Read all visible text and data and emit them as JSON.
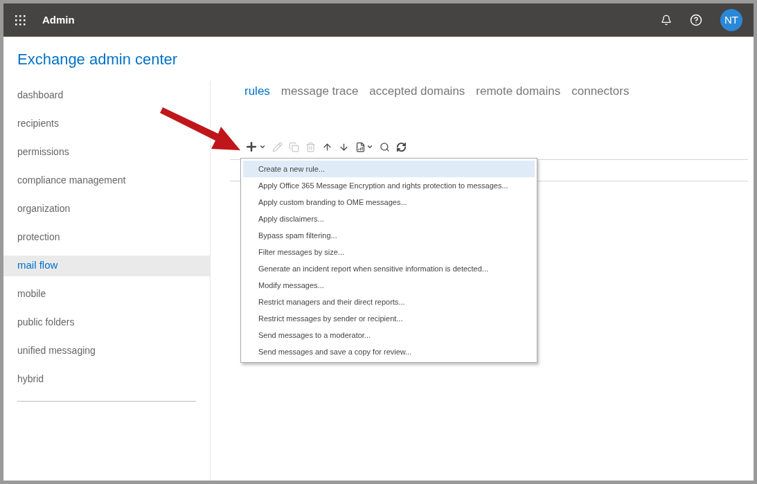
{
  "top_bar": {
    "app_title": "Admin",
    "avatar_initials": "NT"
  },
  "page_title": "Exchange admin center",
  "sidebar": {
    "items": [
      {
        "label": "dashboard",
        "selected": false
      },
      {
        "label": "recipients",
        "selected": false
      },
      {
        "label": "permissions",
        "selected": false
      },
      {
        "label": "compliance management",
        "selected": false
      },
      {
        "label": "organization",
        "selected": false
      },
      {
        "label": "protection",
        "selected": false
      },
      {
        "label": "mail flow",
        "selected": true
      },
      {
        "label": "mobile",
        "selected": false
      },
      {
        "label": "public folders",
        "selected": false
      },
      {
        "label": "unified messaging",
        "selected": false
      },
      {
        "label": "hybrid",
        "selected": false
      }
    ]
  },
  "tabs": [
    {
      "label": "rules",
      "selected": true
    },
    {
      "label": "message trace",
      "selected": false
    },
    {
      "label": "accepted domains",
      "selected": false
    },
    {
      "label": "remote domains",
      "selected": false
    },
    {
      "label": "connectors",
      "selected": false
    }
  ],
  "toolbar": [
    {
      "kind": "add",
      "disabled": false
    },
    {
      "kind": "edit",
      "disabled": true
    },
    {
      "kind": "copy",
      "disabled": true
    },
    {
      "kind": "delete",
      "disabled": true
    },
    {
      "kind": "up",
      "disabled": false
    },
    {
      "kind": "down",
      "disabled": false
    },
    {
      "kind": "report",
      "disabled": false
    },
    {
      "kind": "search",
      "disabled": false
    },
    {
      "kind": "refresh",
      "disabled": false
    }
  ],
  "new_rule_menu": {
    "items": [
      {
        "label": "Create a new rule...",
        "selected": true
      },
      {
        "label": "Apply Office 365 Message Encryption and rights protection to messages...",
        "selected": false
      },
      {
        "label": "Apply custom branding to OME messages...",
        "selected": false
      },
      {
        "label": "Apply disclaimers...",
        "selected": false
      },
      {
        "label": "Bypass spam filtering...",
        "selected": false
      },
      {
        "label": "Filter messages by size...",
        "selected": false
      },
      {
        "label": "Generate an incident report when sensitive information is detected...",
        "selected": false
      },
      {
        "label": "Modify messages...",
        "selected": false
      },
      {
        "label": "Restrict managers and their direct reports...",
        "selected": false
      },
      {
        "label": "Restrict messages by sender or recipient...",
        "selected": false
      },
      {
        "label": "Send messages to a moderator...",
        "selected": false
      },
      {
        "label": "Send messages and save a copy for review...",
        "selected": false
      }
    ]
  }
}
